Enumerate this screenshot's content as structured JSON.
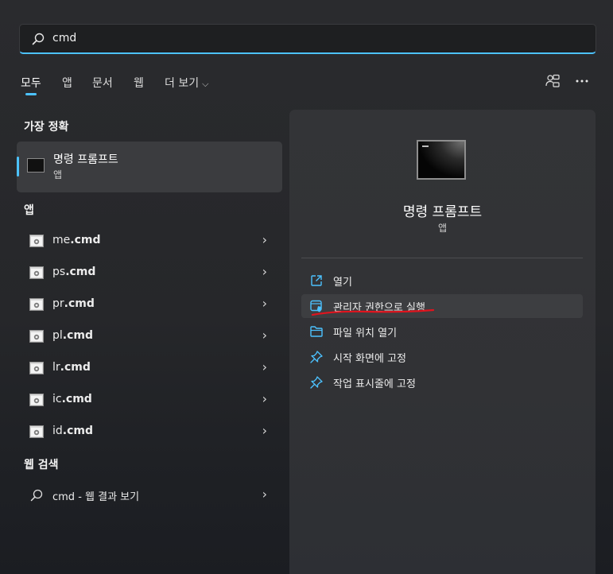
{
  "search": {
    "value": "cmd"
  },
  "tabs": [
    {
      "label": "모두"
    },
    {
      "label": "앱"
    },
    {
      "label": "문서"
    },
    {
      "label": "웹"
    },
    {
      "label": "더 보기"
    }
  ],
  "left": {
    "best_match_title": "가장 정확",
    "best_match": {
      "name": "명령 프롬프트",
      "type": "앱"
    },
    "apps_title": "앱",
    "apps": [
      {
        "name": "me",
        "ext": ".cmd"
      },
      {
        "name": "ps",
        "ext": ".cmd"
      },
      {
        "name": "pr",
        "ext": ".cmd"
      },
      {
        "name": "pl",
        "ext": ".cmd"
      },
      {
        "name": "lr",
        "ext": ".cmd"
      },
      {
        "name": "ic",
        "ext": ".cmd"
      },
      {
        "name": "id",
        "ext": ".cmd"
      }
    ],
    "web_title": "웹 검색",
    "web_result": "cmd - 웹 결과 보기"
  },
  "right": {
    "title": "명령 프롬프트",
    "subtitle": "앱",
    "actions": [
      {
        "label": "열기",
        "icon": "open-external-icon"
      },
      {
        "label": "관리자 권한으로 실행",
        "icon": "shield-admin-icon"
      },
      {
        "label": "파일 위치 열기",
        "icon": "folder-icon"
      },
      {
        "label": "시작 화면에 고정",
        "icon": "pin-icon"
      },
      {
        "label": "작업 표시줄에 고정",
        "icon": "pin-icon"
      }
    ]
  },
  "colors": {
    "accent": "#4cc2ff",
    "annotation": "#e0141e"
  }
}
